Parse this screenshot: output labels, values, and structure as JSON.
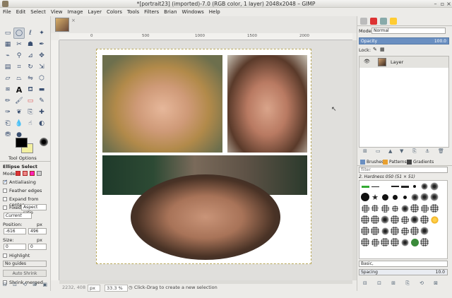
{
  "window": {
    "title": "*[portrait23] (imported)-7.0 (RGB color, 1 layer) 2048x2048 – GIMP"
  },
  "menu": [
    "File",
    "Edit",
    "Select",
    "View",
    "Image",
    "Layer",
    "Colors",
    "Tools",
    "Filters",
    "Brian",
    "Windows",
    "Help"
  ],
  "tool_options": {
    "tab_label": "Tool Options",
    "title": "Ellipse Select",
    "mode_label": "Mode:",
    "antialiasing": "Antialiasing",
    "feather": "Feather edges",
    "expand": "Expand from center",
    "fixed": "Fixed",
    "fixed_value": "Aspect ratio",
    "current": "Current",
    "position_label": "Position:",
    "pos_unit": "px",
    "pos_x": "-616",
    "pos_y": "496",
    "size_label": "Size:",
    "size_unit": "px",
    "size_w": "0",
    "size_h": "0",
    "highlight": "Highlight",
    "guides": "No guides",
    "autoshrink": "Auto Shrink",
    "shrink_merged": "Shrink merged"
  },
  "rulers": [
    "0",
    "500",
    "1000",
    "1500",
    "2000"
  ],
  "status": {
    "coords": "2232, 408",
    "unit": "px",
    "zoom": "33.3 %",
    "message": "Click-Drag to create a new selection"
  },
  "layers_panel": {
    "mode_label": "Mode:",
    "mode_value": "Normal",
    "opacity_label": "Opacity",
    "opacity_value": "100.0",
    "lock_label": "Lock:",
    "layer_name": "Layer"
  },
  "brushes_panel": {
    "tabs": [
      "Brushes",
      "Patterns",
      "Gradients"
    ],
    "filter_placeholder": "filter",
    "current_brush": "2. Hardness 050 (51 × 51)",
    "preset": "Basic,",
    "spacing_label": "Spacing",
    "spacing_value": "10.0"
  },
  "colors": {
    "fg": "#000000",
    "bg": "#f3f0a0",
    "accent": "#6a8fc1"
  }
}
